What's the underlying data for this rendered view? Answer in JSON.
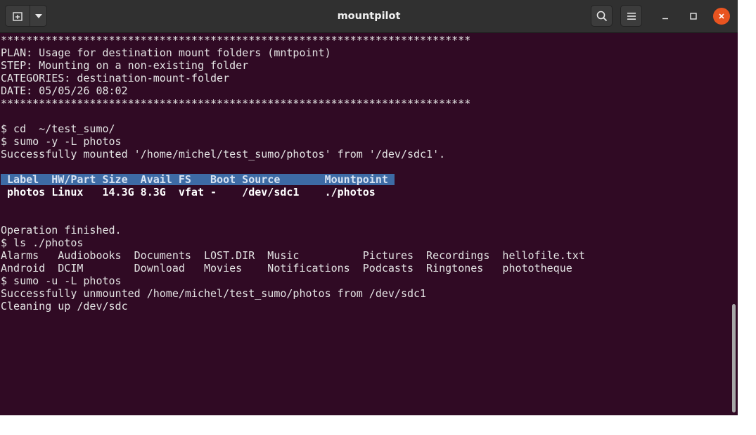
{
  "window": {
    "title": "mountpilot"
  },
  "icons": {
    "new_tab": "new-tab-icon",
    "dropdown": "chevron-down-icon",
    "search": "search-icon",
    "menu": "hamburger-menu-icon",
    "minimize": "minimize-icon",
    "maximize": "maximize-icon",
    "close": "close-icon"
  },
  "colors": {
    "terminal_bg": "#300a24",
    "titlebar_bg": "#303030",
    "close_button": "#e95420",
    "table_header_bg": "#3d6ba5"
  },
  "terminal": {
    "stars": "**************************************************************************",
    "plan": "PLAN: Usage for destination mount folders (mntpoint)",
    "step": "STEP: Mounting on a non-existing folder",
    "categories": "CATEGORIES: destination-mount-folder",
    "date": "DATE: 05/05/26 08:02",
    "cmd_cd": "$ cd  ~/test_sumo/",
    "cmd_mount": "$ sumo -y -L photos",
    "mount_result": "Successfully mounted '/home/michel/test_sumo/photos' from '/dev/sdc1'.",
    "table_header": " Label  HW/Part Size  Avail FS   Boot Source       Mountpoint ",
    "table_row": " photos Linux   14.3G 8.3G  vfat -    /dev/sdc1    ./photos",
    "operation_finished": "Operation finished.",
    "cmd_ls": "$ ls ./photos",
    "ls_row1": "Alarms   Audiobooks  Documents  LOST.DIR  Music          Pictures  Recordings  hellofile.txt",
    "ls_row2": "Android  DCIM        Download   Movies    Notifications  Podcasts  Ringtones   phototheque",
    "cmd_umount": "$ sumo -u -L photos",
    "umount_result": "Successfully unmounted /home/michel/test_sumo/photos from /dev/sdc1",
    "cleanup": "Cleaning up /dev/sdc"
  }
}
